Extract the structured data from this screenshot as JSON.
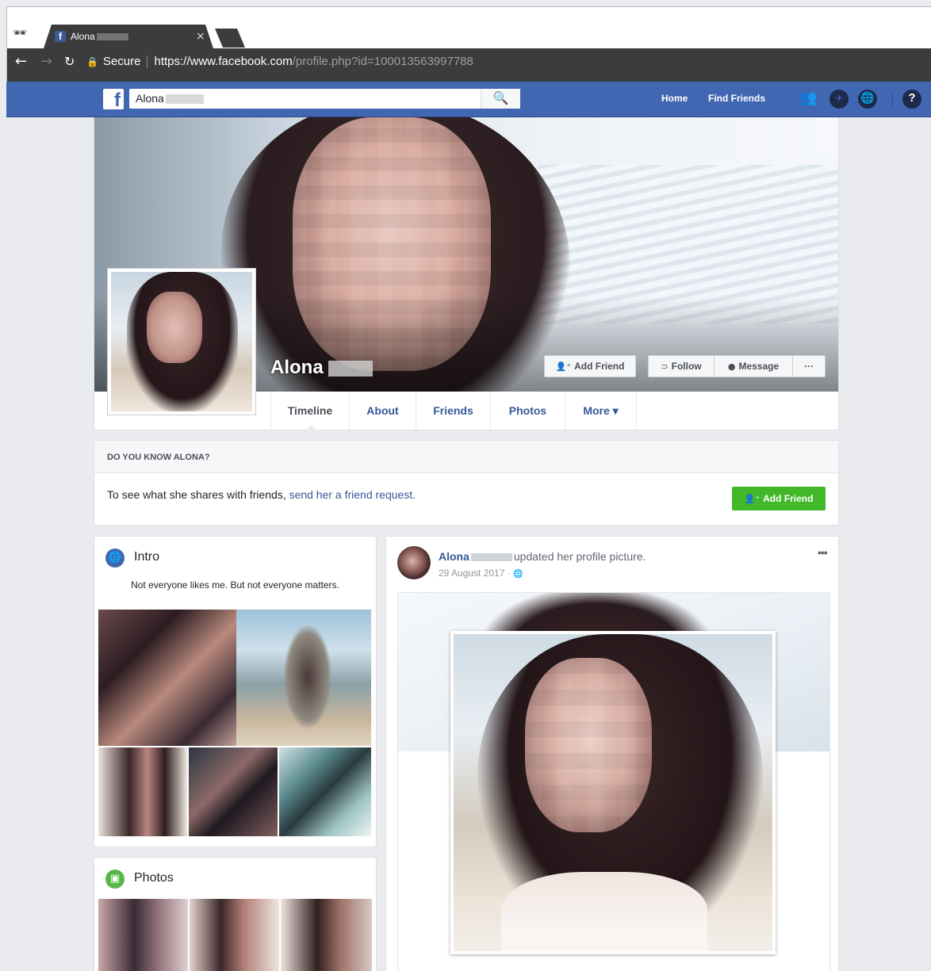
{
  "browser": {
    "tab_title": "Alona",
    "tab_close": "×",
    "secure_label": "Secure",
    "url_main": "https://www.facebook.com",
    "url_rest": "/profile.php?id=100013563997788"
  },
  "topbar": {
    "logo": "f",
    "search_value": "Alona",
    "nav_home": "Home",
    "nav_find_friends": "Find Friends"
  },
  "profile": {
    "name": "Alona",
    "buttons": {
      "add_friend": "Add Friend",
      "follow": "Follow",
      "message": "Message",
      "more": "···"
    },
    "tabs": [
      {
        "label": "Timeline"
      },
      {
        "label": "About"
      },
      {
        "label": "Friends"
      },
      {
        "label": "Photos"
      },
      {
        "label": "More ▾"
      }
    ]
  },
  "know_card": {
    "heading": "DO YOU KNOW ALONA?",
    "text": "To see what she shares with friends, ",
    "link": "send her a friend request.",
    "button": "Add Friend"
  },
  "intro": {
    "title": "Intro",
    "bio": "Not everyone likes me. But not everyone matters."
  },
  "photos": {
    "title": "Photos"
  },
  "post": {
    "author": "Alona",
    "action": "updated her profile picture.",
    "date": "29 August 2017 ·",
    "more": "•••"
  },
  "colors": {
    "fb_blue": "#4267b2",
    "link": "#365899",
    "green": "#42b72a"
  }
}
